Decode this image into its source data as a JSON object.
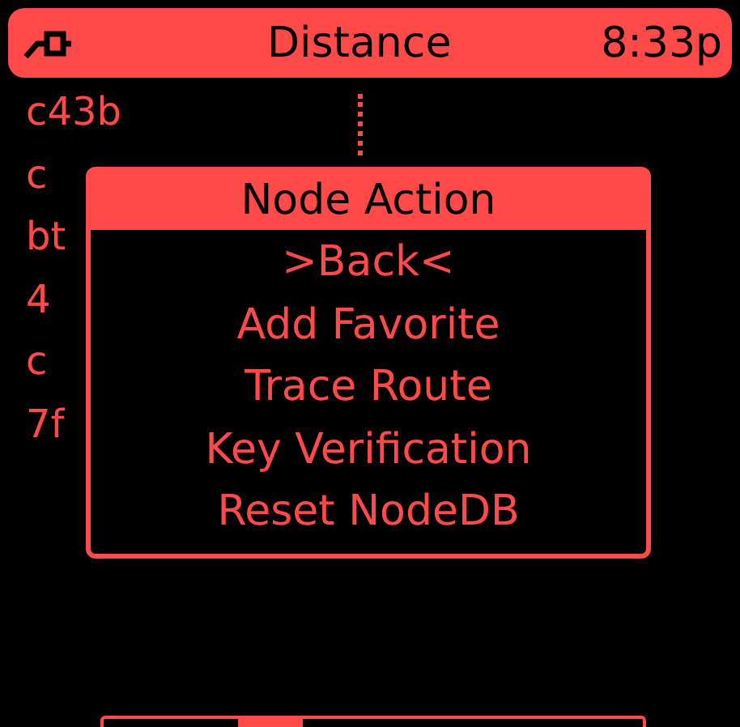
{
  "header": {
    "title": "Distance",
    "time": "8:33p"
  },
  "nodes": [
    "c43b",
    "c",
    "bt",
    "4",
    "c",
    "7f"
  ],
  "menu": {
    "title": "Node Action",
    "items": [
      ">Back<",
      "Add Favorite",
      "Trace Route",
      "Key Verification",
      "Reset NodeDB"
    ]
  }
}
